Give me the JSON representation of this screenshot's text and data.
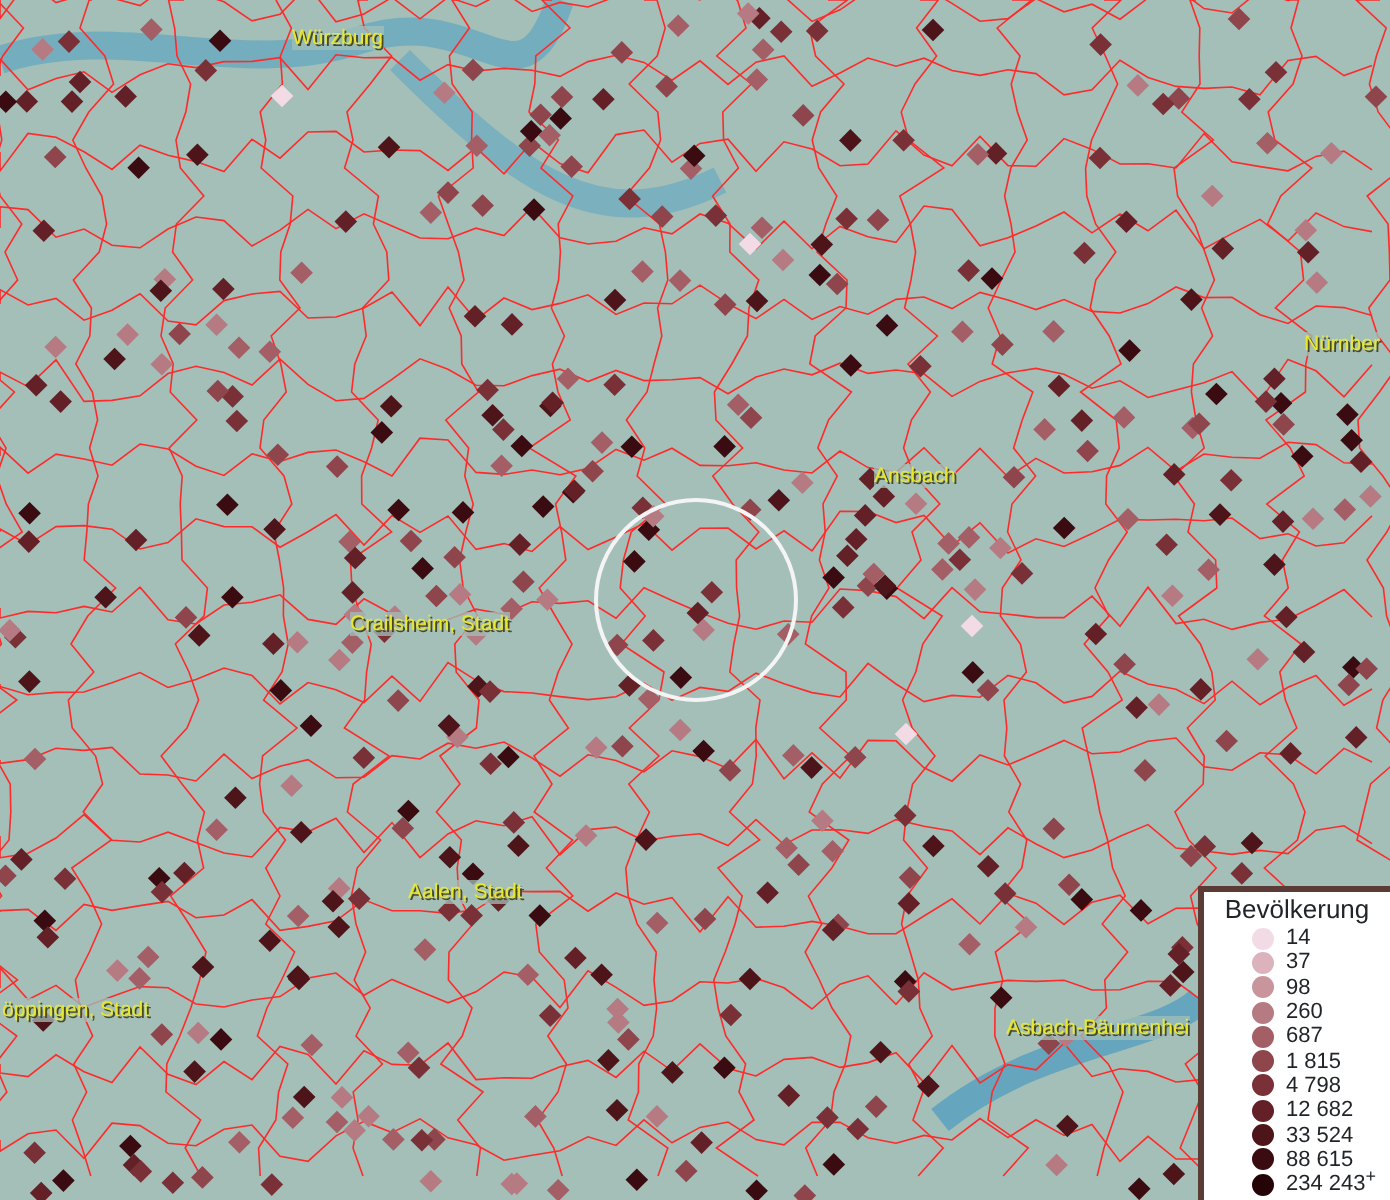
{
  "map": {
    "places": [
      {
        "name": "Würzburg"
      },
      {
        "name": "Nürnber"
      },
      {
        "name": "Ansbach"
      },
      {
        "name": "Crailsheim, Stadt"
      },
      {
        "name": "Aalen, Stadt"
      },
      {
        "name": "öppingen, Stadt"
      },
      {
        "name": "Asbach-Bäumenhei"
      }
    ]
  },
  "legend": {
    "title": "Bevölkerung",
    "classes": [
      {
        "value": "14",
        "color": "#f3dbe6"
      },
      {
        "value": "37",
        "color": "#dcb3bd"
      },
      {
        "value": "98",
        "color": "#c8959d"
      },
      {
        "value": "260",
        "color": "#b57a82"
      },
      {
        "value": "687",
        "color": "#a35e66"
      },
      {
        "value": "1 815",
        "color": "#8e454c"
      },
      {
        "value": "4 798",
        "color": "#7a3037"
      },
      {
        "value": "12 682",
        "color": "#632027"
      },
      {
        "value": "33 524",
        "color": "#4d1419"
      },
      {
        "value": "88 615",
        "color": "#3a0b10"
      },
      {
        "value": "234 243$^{+}$",
        "color": "#250407"
      }
    ]
  }
}
